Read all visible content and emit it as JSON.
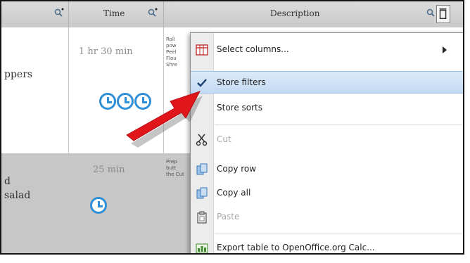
{
  "header": {
    "time_label": "Time",
    "description_label": "Description"
  },
  "rows": [
    {
      "name": "ppers",
      "time": "1 hr 30 min",
      "clocks": 3,
      "description": "Roll pow Peel Flou Shre"
    },
    {
      "name_line1": "d",
      "name_line2": "salad",
      "time": "25 min",
      "clocks": 1,
      "description": "Prep butt the Cut"
    }
  ],
  "menu": {
    "items": [
      {
        "label": "Select columns...",
        "icon": "table-columns-icon",
        "enabled": true,
        "submenu": true
      },
      {
        "label": "Store filters",
        "icon": "checkmark-icon",
        "enabled": true,
        "checked": true,
        "highlighted": true
      },
      {
        "label": "Store sorts",
        "icon": "",
        "enabled": true
      },
      {
        "label": "Cut",
        "icon": "scissors-icon",
        "enabled": false
      },
      {
        "label": "Copy row",
        "icon": "copy-icon",
        "enabled": true
      },
      {
        "label": "Copy all",
        "icon": "copy-icon",
        "enabled": true
      },
      {
        "label": "Paste",
        "icon": "clipboard-icon",
        "enabled": false
      },
      {
        "label": "Export table to OpenOffice.org Calc...",
        "icon": "spreadsheet-icon",
        "enabled": true
      }
    ]
  },
  "colors": {
    "accent_blue": "#2f8fd7",
    "highlight": "#c3daf3",
    "arrow_red": "#e0161b"
  }
}
